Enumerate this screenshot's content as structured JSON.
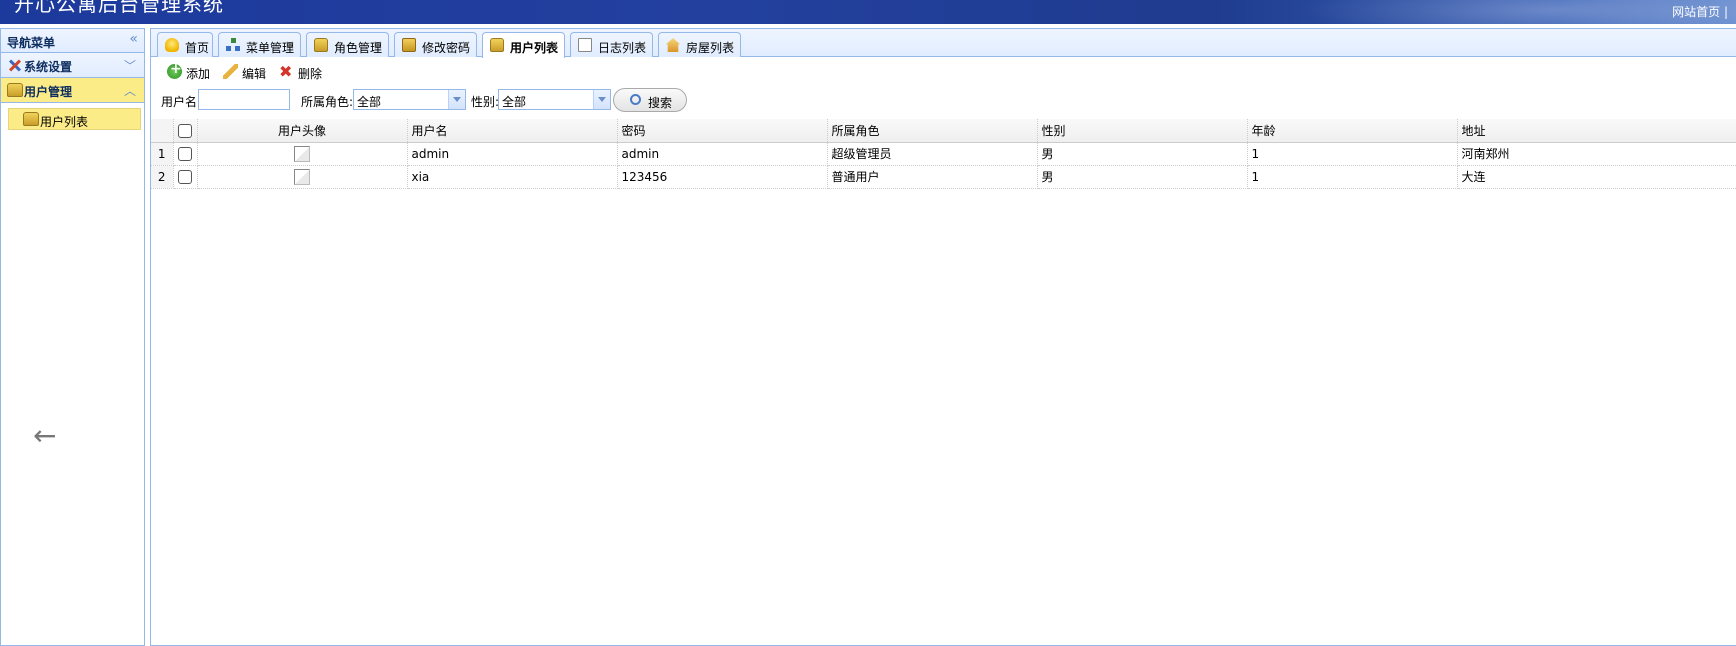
{
  "header": {
    "title": "开心公寓后台管理系统",
    "site_link": "网站首页 |"
  },
  "sidebar": {
    "nav_title": "导航菜单",
    "collapse_icon": "double-chevron-left-icon",
    "panels": [
      {
        "label": "系统设置",
        "icon": "tools-icon",
        "toggle": "﹀",
        "expanded": false
      },
      {
        "label": "用户管理",
        "icon": "user-group-icon",
        "toggle": "︿",
        "expanded": true
      }
    ],
    "items": [
      {
        "label": "用户列表",
        "icon": "user-group-icon",
        "selected": true
      }
    ],
    "back_icon": "←"
  },
  "tabs": [
    {
      "label": "首页",
      "icon": "lightbulb-icon",
      "closable": false
    },
    {
      "label": "菜单管理",
      "icon": "sitemap-icon",
      "closable": true
    },
    {
      "label": "角色管理",
      "icon": "user-group-icon",
      "closable": true
    },
    {
      "label": "修改密码",
      "icon": "lock-icon",
      "closable": true
    },
    {
      "label": "用户列表",
      "icon": "user-group-icon",
      "closable": true,
      "selected": true
    },
    {
      "label": "日志列表",
      "icon": "document-icon",
      "closable": true
    },
    {
      "label": "房屋列表",
      "icon": "house-icon",
      "closable": true
    }
  ],
  "tab_close_glyph": "×",
  "toolbar": {
    "add_label": "添加",
    "edit_label": "编辑",
    "delete_label": "删除"
  },
  "search": {
    "username_label": "用户名:",
    "username_value": "",
    "role_label": "所属角色:",
    "role_value": "全部",
    "gender_label": "性别:",
    "gender_value": "全部",
    "search_label": "搜索"
  },
  "table": {
    "columns": [
      "用户头像",
      "用户名",
      "密码",
      "所属角色",
      "性别",
      "年龄",
      "地址"
    ],
    "rows": [
      {
        "num": "1",
        "username": "admin",
        "password": "admin",
        "role": "超级管理员",
        "gender": "男",
        "age": "1",
        "address": "河南郑州"
      },
      {
        "num": "2",
        "username": "xia",
        "password": "123456",
        "role": "普通用户",
        "gender": "男",
        "age": "1",
        "address": "大连"
      }
    ]
  },
  "colors": {
    "header_blue": "#1c3a9c",
    "panel_border": "#95b8e7",
    "highlight_yellow": "#fbec88"
  }
}
